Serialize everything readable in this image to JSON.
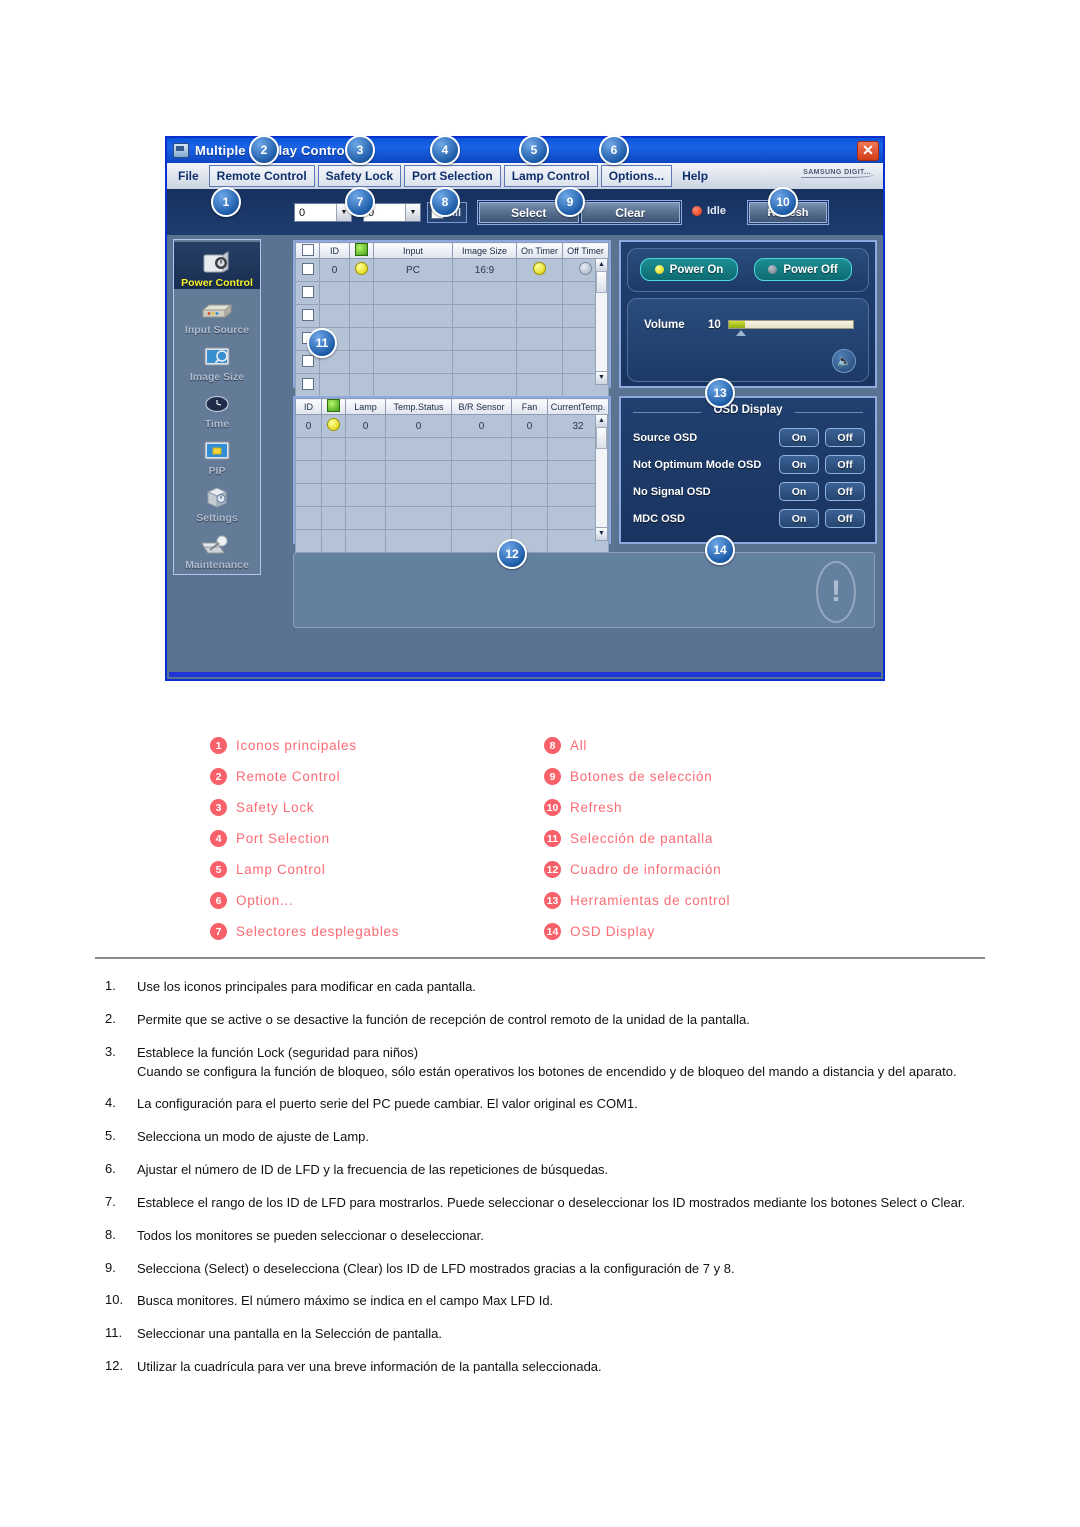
{
  "app": {
    "title": "Multiple Display Control",
    "title_icon": "monitor-icon",
    "close_icon": "close-icon",
    "brand": "SAMSUNG DIGIT...",
    "menu": [
      {
        "label": "File",
        "boxed": false
      },
      {
        "label": "Remote Control",
        "boxed": true
      },
      {
        "label": "Safety Lock",
        "boxed": true
      },
      {
        "label": "Port Selection",
        "boxed": true
      },
      {
        "label": "Lamp Control",
        "boxed": true
      },
      {
        "label": "Options...",
        "boxed": true
      },
      {
        "label": "Help",
        "boxed": false
      }
    ],
    "toolbar": {
      "combo_from": "0",
      "combo_to": "0",
      "all_label": "All",
      "select_label": "Select",
      "clear_label": "Clear",
      "status_label": "Idle",
      "refresh_label": "Refresh"
    },
    "sidebar": [
      {
        "label": "Power Control",
        "icon": "power-control-icon",
        "active": true
      },
      {
        "label": "Input Source",
        "icon": "input-source-icon",
        "active": false
      },
      {
        "label": "Image Size",
        "icon": "image-size-icon",
        "active": false
      },
      {
        "label": "Time",
        "icon": "clock-icon",
        "active": false
      },
      {
        "label": "PIP",
        "icon": "pip-icon",
        "active": false
      },
      {
        "label": "Settings",
        "icon": "settings-cube-icon",
        "active": false
      },
      {
        "label": "Maintenance",
        "icon": "maintenance-icon",
        "active": false
      }
    ],
    "grid_top": {
      "headers": [
        "",
        "ID",
        "",
        "Input",
        "Image Size",
        "On Timer",
        "Off Timer"
      ],
      "rows": [
        [
          "",
          "0",
          "on",
          "PC",
          "16:9",
          "on",
          "off"
        ],
        [
          "",
          "",
          "",
          "",
          "",
          "",
          ""
        ],
        [
          "",
          "",
          "",
          "",
          "",
          "",
          ""
        ],
        [
          "",
          "",
          "",
          "",
          "",
          "",
          ""
        ],
        [
          "",
          "",
          "",
          "",
          "",
          "",
          ""
        ],
        [
          "",
          "",
          "",
          "",
          "",
          "",
          ""
        ]
      ]
    },
    "grid_bottom": {
      "headers": [
        "ID",
        "",
        "Lamp",
        "Temp.Status",
        "B/R Sensor",
        "Fan",
        "CurrentTemp."
      ],
      "rows": [
        [
          "0",
          "on",
          "0",
          "0",
          "0",
          "0",
          "32"
        ],
        [
          "",
          "",
          "",
          "",
          "",
          "",
          ""
        ],
        [
          "",
          "",
          "",
          "",
          "",
          "",
          ""
        ],
        [
          "",
          "",
          "",
          "",
          "",
          "",
          ""
        ],
        [
          "",
          "",
          "",
          "",
          "",
          "",
          ""
        ],
        [
          "",
          "",
          "",
          "",
          "",
          "",
          ""
        ]
      ]
    },
    "tools": {
      "power_on_label": "Power On",
      "power_off_label": "Power Off",
      "volume_label": "Volume",
      "volume_value": "10",
      "speaker_icon": "speaker-icon"
    },
    "osd": {
      "title": "OSD Display",
      "on_label": "On",
      "off_label": "Off",
      "rows": [
        {
          "label": "Source OSD"
        },
        {
          "label": "Not Optimum Mode OSD"
        },
        {
          "label": "No Signal OSD"
        },
        {
          "label": "MDC OSD"
        }
      ]
    },
    "info_box": {
      "icon": "exclamation-icon"
    }
  },
  "callouts": [
    {
      "n": "1"
    },
    {
      "n": "2"
    },
    {
      "n": "3"
    },
    {
      "n": "4"
    },
    {
      "n": "5"
    },
    {
      "n": "6"
    },
    {
      "n": "7"
    },
    {
      "n": "8"
    },
    {
      "n": "9"
    },
    {
      "n": "10"
    },
    {
      "n": "11"
    },
    {
      "n": "12"
    },
    {
      "n": "13"
    },
    {
      "n": "14"
    }
  ],
  "legend": {
    "left": [
      {
        "n": "1",
        "label": "Iconos principales"
      },
      {
        "n": "2",
        "label": "Remote Control"
      },
      {
        "n": "3",
        "label": "Safety Lock"
      },
      {
        "n": "4",
        "label": "Port Selection"
      },
      {
        "n": "5",
        "label": "Lamp Control"
      },
      {
        "n": "6",
        "label": "Option..."
      },
      {
        "n": "7",
        "label": "Selectores desplegables"
      }
    ],
    "right": [
      {
        "n": "8",
        "label": "All"
      },
      {
        "n": "9",
        "label": "Botones de selección"
      },
      {
        "n": "10",
        "label": "Refresh"
      },
      {
        "n": "11",
        "label": "Selección de pantalla"
      },
      {
        "n": "12",
        "label": "Cuadro de información"
      },
      {
        "n": "13",
        "label": "Herramientas de control"
      },
      {
        "n": "14",
        "label": "OSD Display"
      }
    ]
  },
  "steps": [
    {
      "n": "1.",
      "lines": [
        "Use los iconos principales para modificar en cada pantalla."
      ]
    },
    {
      "n": "2.",
      "lines": [
        "Permite que se active o se desactive la función de recepción de control remoto de la unidad de la pantalla."
      ]
    },
    {
      "n": "3.",
      "lines": [
        "Establece la función Lock (seguridad para niños)",
        "Cuando se configura la función de bloqueo, sólo están operativos los botones de encendido y de bloqueo del mando a distancia y del aparato."
      ]
    },
    {
      "n": "4.",
      "lines": [
        "La configuración para el puerto serie del PC puede cambiar. El valor original es COM1."
      ]
    },
    {
      "n": "5.",
      "lines": [
        "Selecciona un modo de ajuste de Lamp."
      ]
    },
    {
      "n": "6.",
      "lines": [
        "Ajustar el número de ID de LFD y la frecuencia de las repeticiones de búsquedas."
      ]
    },
    {
      "n": "7.",
      "lines": [
        "Establece el rango de los ID de LFD para mostrarlos. Puede seleccionar o deseleccionar los ID mostrados mediante los botones Select o Clear."
      ]
    },
    {
      "n": "8.",
      "lines": [
        "Todos los monitores se pueden seleccionar o deseleccionar."
      ]
    },
    {
      "n": "9.",
      "lines": [
        "Selecciona (Select) o deselecciona (Clear) los ID de LFD mostrados gracias a la configuración de 7 y 8."
      ]
    },
    {
      "n": "10.",
      "lines": [
        "Busca monitores. El número máximo se indica en el campo Max LFD Id."
      ]
    },
    {
      "n": "11.",
      "lines": [
        "Seleccionar una pantalla en la Selección de pantalla."
      ]
    },
    {
      "n": "12.",
      "lines": [
        "Utilizar la cuadrícula para ver una breve información de la pantalla seleccionada."
      ]
    }
  ],
  "colors": {
    "badge_blue": "#1d5ca8",
    "badge_red": "#f8606a",
    "legend_text": "#fb6b74",
    "titlebar": "#0c46c0",
    "app_bg": "#5a7391"
  }
}
